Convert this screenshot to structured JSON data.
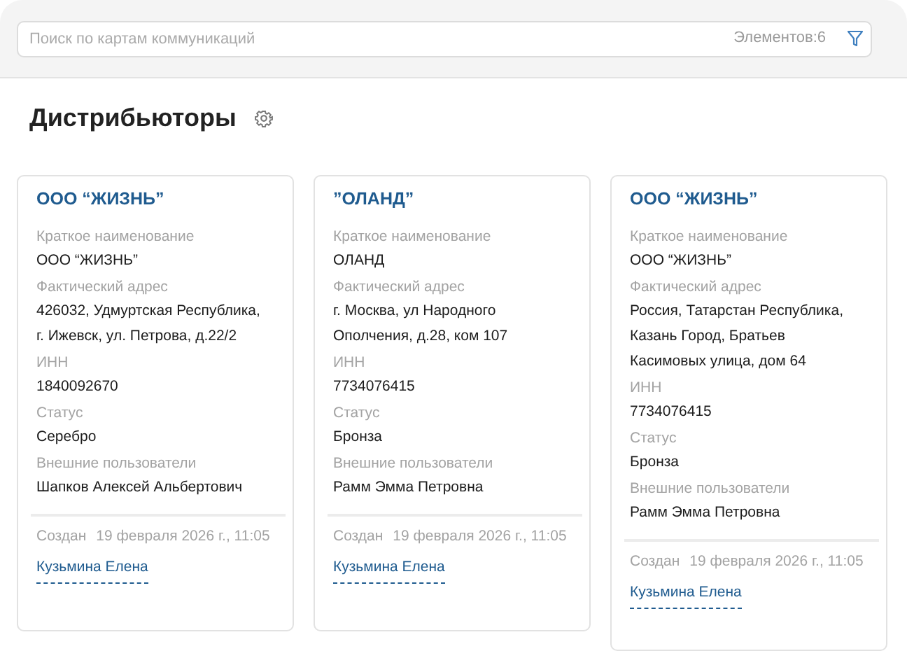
{
  "search": {
    "placeholder": "Поиск по картам коммуникаций",
    "count": "Элементов:6"
  },
  "title": "Дистрибьюторы",
  "cards": [
    {
      "name": "ООО “ЖИЗНЬ”",
      "fields": [
        {
          "label": "Краткое наименование",
          "lines": [
            "ООО “ЖИЗНЬ”"
          ]
        },
        {
          "label": "Фактический адрес",
          "lines": [
            "426032, Удмуртская Республика,",
            "г. Ижевск, ул. Петрова, д.22/2"
          ]
        },
        {
          "label": "ИНН",
          "lines": [
            "1840092670"
          ]
        },
        {
          "label": "Статус",
          "lines": [
            "Серебро"
          ]
        },
        {
          "label": "Внешние пользователи",
          "lines": [
            "Шапков Алексей Альбертович"
          ]
        }
      ],
      "created_label": "Создан",
      "created_date": "19 февраля 2026 г., 11:05",
      "author": "Кузьмина Елена"
    },
    {
      "name": "”ОЛАНД”",
      "fields": [
        {
          "label": "Краткое наименование",
          "lines": [
            "ОЛАНД"
          ]
        },
        {
          "label": "Фактический адрес",
          "lines": [
            "г. Москва, ул Народного",
            "Ополчения, д.28, ком 107"
          ]
        },
        {
          "label": "ИНН",
          "lines": [
            "7734076415"
          ]
        },
        {
          "label": "Статус",
          "lines": [
            "Бронза"
          ]
        },
        {
          "label": "Внешние пользователи",
          "lines": [
            "Рамм Эмма Петровна"
          ]
        }
      ],
      "created_label": "Создан",
      "created_date": "19 февраля 2026 г., 11:05",
      "author": "Кузьмина Елена"
    },
    {
      "name": "ООО “ЖИЗНЬ”",
      "fields": [
        {
          "label": "Краткое наименование",
          "lines": [
            "ООО “ЖИЗНЬ”"
          ]
        },
        {
          "label": "Фактический адрес",
          "lines": [
            "Россия, Татарстан Республика,",
            "Казань Город, Братьев",
            "Касимовых улица, дом 64"
          ]
        },
        {
          "label": "ИНН",
          "lines": [
            "7734076415"
          ]
        },
        {
          "label": "Статус",
          "lines": [
            "Бронза"
          ]
        },
        {
          "label": "Внешние пользователи",
          "lines": [
            "Рамм Эмма Петровна"
          ]
        }
      ],
      "created_label": "Создан",
      "created_date": "19 февраля 2026 г., 11:05",
      "author": "Кузьмина Елена"
    }
  ]
}
